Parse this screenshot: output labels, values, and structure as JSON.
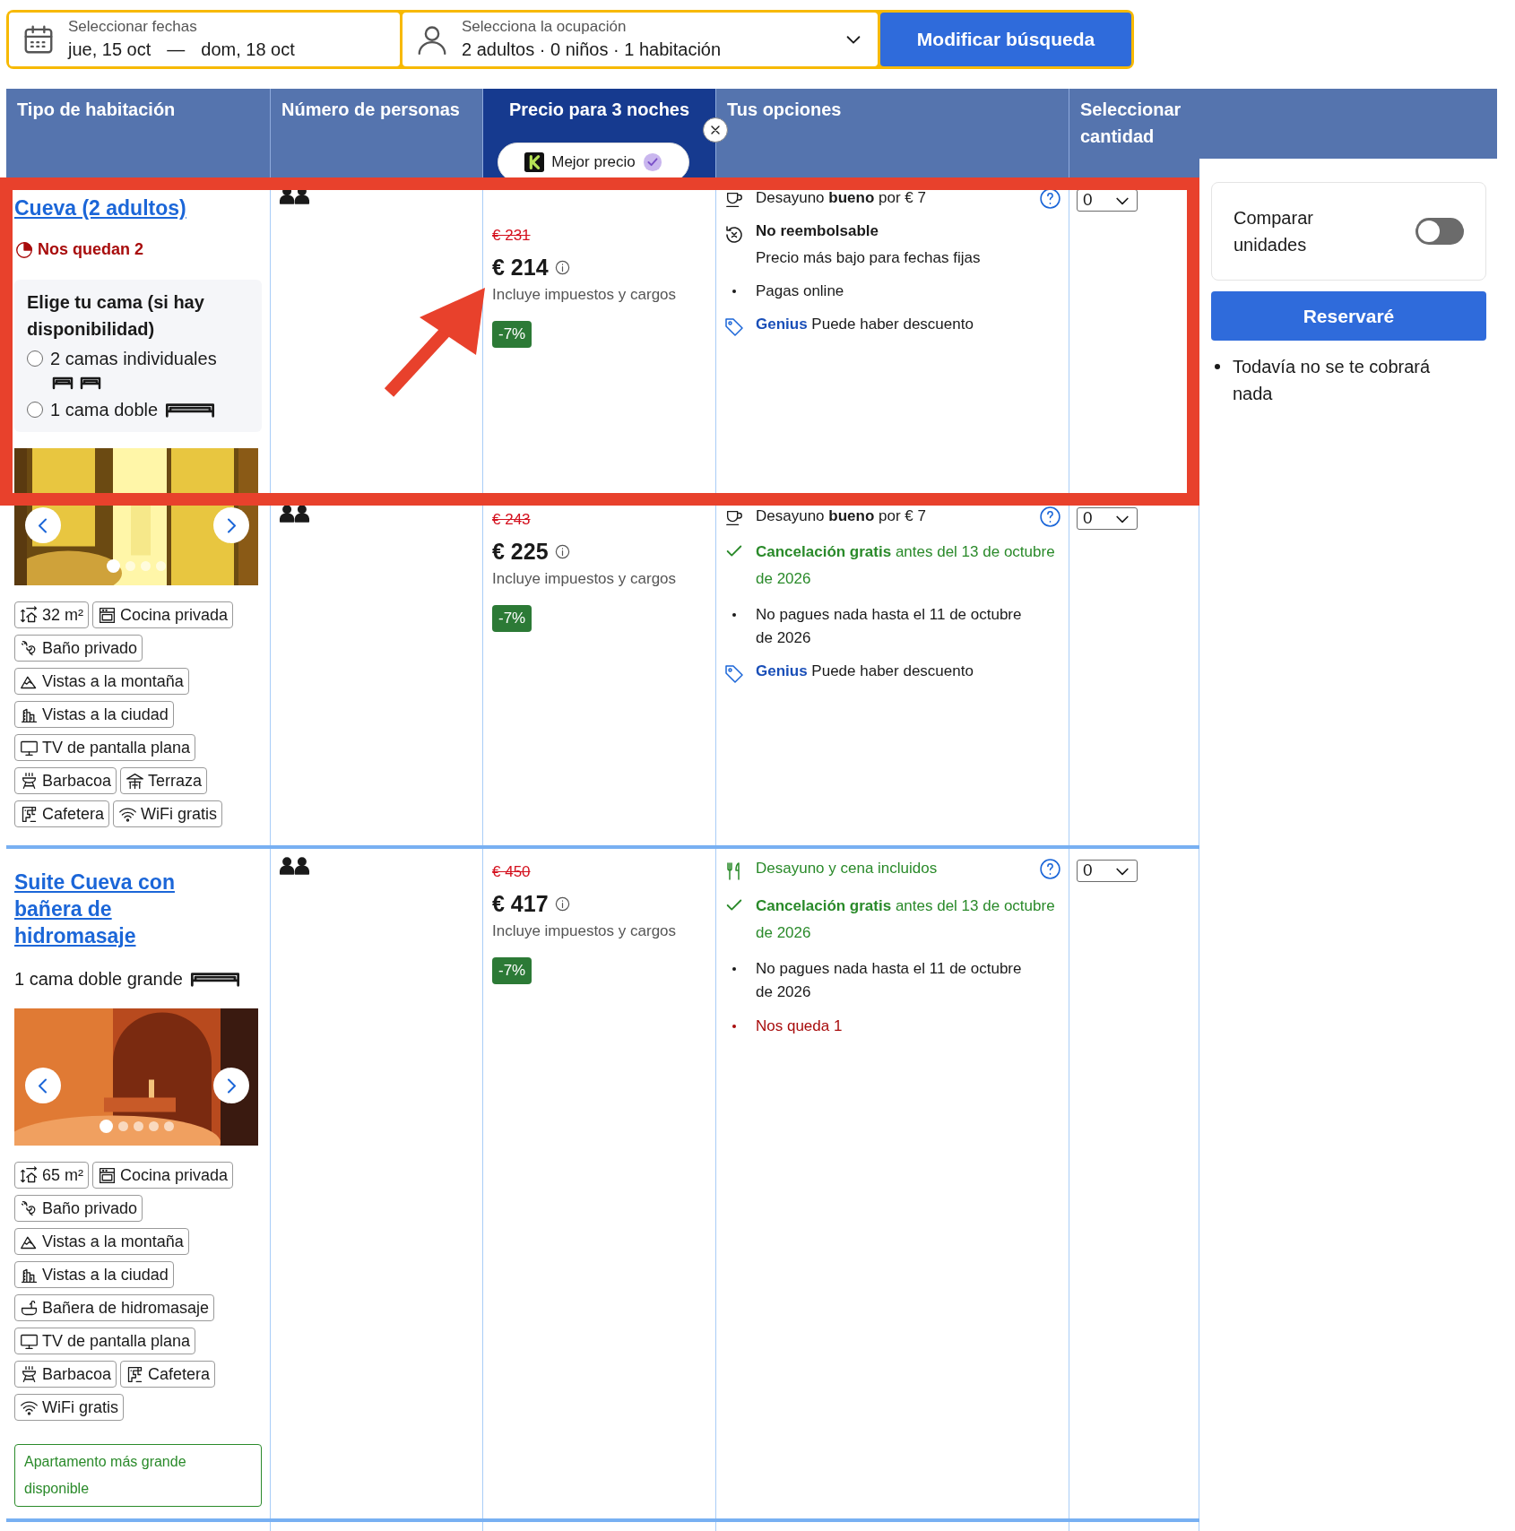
{
  "search": {
    "dates_label": "Seleccionar fechas",
    "check_in": "jue, 15 oct",
    "separator": "—",
    "check_out": "dom, 18 oct",
    "occupancy_label": "Selecciona la ocupación",
    "occupancy_value": "2 adultos · 0 niños · 1 habitación",
    "button": "Modificar búsqueda"
  },
  "columns": [
    {
      "label": "Tipo de habitación",
      "highlighted": false
    },
    {
      "label": "Número de personas",
      "highlighted": false
    },
    {
      "label": "Precio para 3 noches",
      "highlighted": true,
      "badge": "Mejor precio"
    },
    {
      "label": "Tus opciones",
      "highlighted": false
    },
    {
      "label": "Seleccionar cantidad",
      "highlighted": false
    }
  ],
  "rooms": [
    {
      "name": "Cueva (2 adultos)",
      "availability": "Nos quedan 2",
      "bed_choice": {
        "title": "Elige tu cama (si hay disponibilidad)",
        "options": [
          {
            "label": "2 camas individuales",
            "kind": "twin",
            "selected": false
          },
          {
            "label": "1 cama doble",
            "kind": "double",
            "selected": false
          }
        ]
      },
      "photo_dots": [
        {
          "selected": true
        },
        {
          "selected": false
        },
        {
          "selected": false
        },
        {
          "selected": false
        }
      ],
      "amenities": [
        {
          "kind": "size",
          "label": "32 m²"
        },
        {
          "kind": "kitchen",
          "label": "Cocina privada"
        },
        {
          "kind": "bath",
          "label": "Baño privado"
        },
        {
          "kind": "mountain",
          "label": "Vistas a la montaña"
        },
        {
          "kind": "city",
          "label": "Vistas a la ciudad"
        },
        {
          "kind": "tv",
          "label": "TV de pantalla plana"
        },
        {
          "kind": "bbq",
          "label": "Barbacoa"
        },
        {
          "kind": "terrace",
          "label": "Terraza"
        },
        {
          "kind": "coffee",
          "label": "Cafetera"
        },
        {
          "kind": "wifi",
          "label": "WiFi gratis"
        }
      ],
      "options": [
        {
          "old_price": "€ 231",
          "price": "€ 214",
          "taxes": "Incluye impuestos y cargos",
          "discount": "-7%",
          "quantity": "0",
          "conditions": [
            {
              "kind": "meal",
              "text": "Desayuno **bueno** por € 7",
              "help": true
            },
            {
              "kind": "non_refundable",
              "title": "No reembolsable",
              "text": "Precio más bajo para fechas fijas"
            },
            {
              "kind": "bullet",
              "text": "Pagas online"
            },
            {
              "kind": "genius",
              "label": "Genius",
              "text": "Puede haber descuento"
            }
          ]
        },
        {
          "old_price": "€ 243",
          "price": "€ 225",
          "taxes": "Incluye impuestos y cargos",
          "discount": "-7%",
          "quantity": "0",
          "conditions": [
            {
              "kind": "meal",
              "text": "Desayuno **bueno** por € 7",
              "help": true
            },
            {
              "kind": "free_cancel",
              "text": "**Cancelación gratis** antes del 13 de octubre de 2026"
            },
            {
              "kind": "bullet",
              "text": "No pagues nada hasta el 11 de octubre de 2026"
            },
            {
              "kind": "genius",
              "label": "Genius",
              "text": "Puede haber descuento"
            }
          ]
        }
      ]
    },
    {
      "name": "Suite Cueva con bañera de hidromasaje",
      "beds": {
        "label": "1 cama doble grande",
        "kind": "double"
      },
      "photo_dots": [
        {
          "selected": true
        },
        {
          "selected": false
        },
        {
          "selected": false
        },
        {
          "selected": false
        },
        {
          "selected": false
        }
      ],
      "amenities": [
        {
          "kind": "size",
          "label": "65 m²"
        },
        {
          "kind": "kitchen",
          "label": "Cocina privada"
        },
        {
          "kind": "bath",
          "label": "Baño privado"
        },
        {
          "kind": "mountain",
          "label": "Vistas a la montaña"
        },
        {
          "kind": "city",
          "label": "Vistas a la ciudad"
        },
        {
          "kind": "jacuzzi",
          "label": "Bañera de hidromasaje"
        },
        {
          "kind": "tv",
          "label": "TV de pantalla plana"
        },
        {
          "kind": "bbq",
          "label": "Barbacoa"
        },
        {
          "kind": "coffee",
          "label": "Cafetera"
        },
        {
          "kind": "wifi",
          "label": "WiFi gratis"
        }
      ],
      "note": "Apartamento más grande disponible",
      "options": [
        {
          "old_price": "€ 450",
          "price": "€ 417",
          "taxes": "Incluye impuestos y cargos",
          "discount": "-7%",
          "quantity": "0",
          "conditions": [
            {
              "kind": "meal_included",
              "text": "Desayuno y cena incluidos",
              "help": true
            },
            {
              "kind": "free_cancel",
              "text": "**Cancelación gratis** antes del 13 de octubre de 2026"
            },
            {
              "kind": "bullet",
              "text": "No pagues nada hasta el 11 de octubre de 2026"
            },
            {
              "kind": "alert",
              "text": "Nos queda 1"
            }
          ]
        }
      ]
    }
  ],
  "sidebar": {
    "compare": {
      "label": "Comparar unidades",
      "on": false
    },
    "button": "Reservaré",
    "notes": [
      "Todavía no se te cobrará nada"
    ]
  }
}
